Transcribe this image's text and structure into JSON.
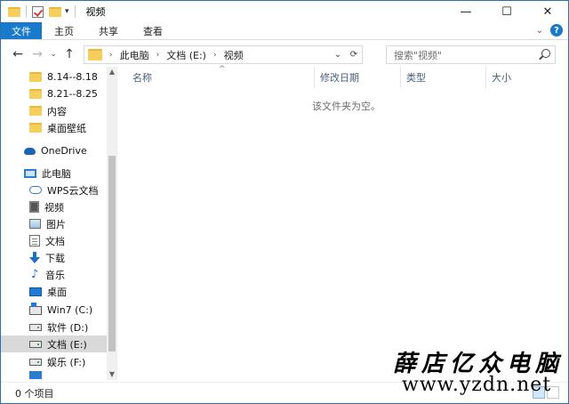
{
  "window": {
    "title": "视频"
  },
  "ribbon": {
    "tabs": [
      "文件",
      "主页",
      "共享",
      "查看"
    ]
  },
  "address": {
    "crumbs": [
      "此电脑",
      "文档 (E:)",
      "视频"
    ]
  },
  "search": {
    "placeholder": "搜索\"视频\""
  },
  "nav_pane": {
    "items": [
      {
        "label": "8.14--8.18",
        "icon": "folder-icon"
      },
      {
        "label": "8.21--8.25",
        "icon": "folder-icon"
      },
      {
        "label": "内容",
        "icon": "folder-icon"
      },
      {
        "label": "桌面壁纸",
        "icon": "folder-icon"
      },
      {
        "label": "OneDrive",
        "icon": "cloud-icon"
      },
      {
        "label": "此电脑",
        "icon": "computer-icon"
      },
      {
        "label": "WPS云文档",
        "icon": "wps-cloud-icon"
      },
      {
        "label": "视频",
        "icon": "video-icon"
      },
      {
        "label": "图片",
        "icon": "pictures-icon"
      },
      {
        "label": "文档",
        "icon": "documents-icon"
      },
      {
        "label": "下载",
        "icon": "download-icon"
      },
      {
        "label": "音乐",
        "icon": "music-icon"
      },
      {
        "label": "桌面",
        "icon": "desktop-icon"
      },
      {
        "label": "Win7 (C:)",
        "icon": "system-drive-icon"
      },
      {
        "label": "软件 (D:)",
        "icon": "drive-icon"
      },
      {
        "label": "文档 (E:)",
        "icon": "drive-icon",
        "selected": true
      },
      {
        "label": "娱乐 (F:)",
        "icon": "drive-icon"
      }
    ]
  },
  "content": {
    "columns": [
      "名称",
      "修改日期",
      "类型",
      "大小"
    ],
    "empty_message": "该文件夹为空。"
  },
  "status": {
    "item_count": "0 个项目"
  },
  "watermark": {
    "title": "薛店亿众电脑",
    "url": "www.yzdn.net"
  }
}
